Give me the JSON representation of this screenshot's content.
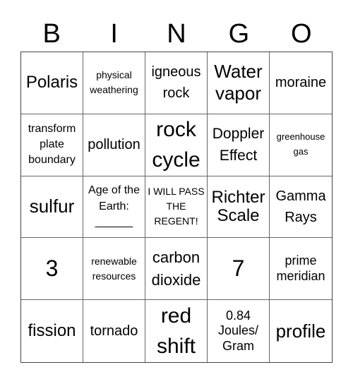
{
  "header": [
    "B",
    "I",
    "N",
    "G",
    "O"
  ],
  "cells": [
    {
      "text": "Polaris",
      "size": "s24"
    },
    {
      "text": "physical weathering",
      "size": "s14"
    },
    {
      "text": "igneous rock",
      "size": "s20"
    },
    {
      "text": "Water vapor",
      "size": "s26"
    },
    {
      "text": "moraine",
      "size": "s20"
    },
    {
      "text": "transform plate boundary",
      "size": "s16"
    },
    {
      "text": "pollution",
      "size": "s20"
    },
    {
      "text": "rock cycle",
      "size": "s30"
    },
    {
      "text": "Doppler Effect",
      "size": "s21"
    },
    {
      "text": "greenhouse gas",
      "size": "s13"
    },
    {
      "text": "sulfur",
      "size": "s26"
    },
    {
      "text": "Age of the Earth: ______",
      "size": "s16"
    },
    {
      "text": "I WILL PASS THE REGENT!",
      "size": "s14"
    },
    {
      "text": "Richter Scale",
      "size": "s24"
    },
    {
      "text": "Gamma Rays",
      "size": "s20"
    },
    {
      "text": "3",
      "size": "s32"
    },
    {
      "text": "renewable resources",
      "size": "s14"
    },
    {
      "text": "carbon dioxide",
      "size": "s22"
    },
    {
      "text": "7",
      "size": "s32"
    },
    {
      "text": "prime meridian",
      "size": "s18"
    },
    {
      "text": "fission",
      "size": "s24"
    },
    {
      "text": "tornado",
      "size": "s20"
    },
    {
      "text": "red shift",
      "size": "s30"
    },
    {
      "text": "0.84 Joules/ Gram",
      "size": "s18"
    },
    {
      "text": "profile",
      "size": "s26"
    }
  ]
}
